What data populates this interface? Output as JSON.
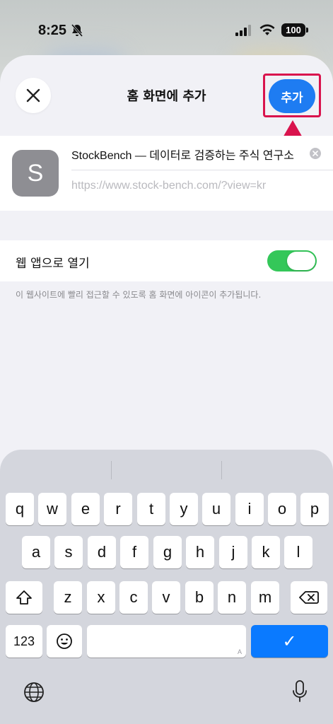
{
  "status_bar": {
    "time": "8:25",
    "battery": "100"
  },
  "sheet": {
    "title": "홈 화면에 추가",
    "add_label": "추가",
    "close_icon": "close-icon"
  },
  "app": {
    "icon_letter": "S",
    "name": "StockBench — 데이터로 검증하는 주식 연구소",
    "url": "https://www.stock-bench.com/?view=kr"
  },
  "web_app": {
    "label": "웹 앱으로 열기",
    "enabled": true
  },
  "footnote": "이 웹사이트에 빨리 접근할 수 있도록 홈 화면에 아이콘이 추가됩니다.",
  "keyboard": {
    "row1": [
      "q",
      "w",
      "e",
      "r",
      "t",
      "y",
      "u",
      "i",
      "o",
      "p"
    ],
    "row2": [
      "a",
      "s",
      "d",
      "f",
      "g",
      "h",
      "j",
      "k",
      "l"
    ],
    "row3": [
      "z",
      "x",
      "c",
      "v",
      "b",
      "n",
      "m"
    ],
    "numbers_label": "123",
    "space_mark": "A",
    "done_symbol": "✓"
  },
  "colors": {
    "accent": "#1e7cf2",
    "toggle_on": "#34c759",
    "highlight": "#d9134d"
  }
}
